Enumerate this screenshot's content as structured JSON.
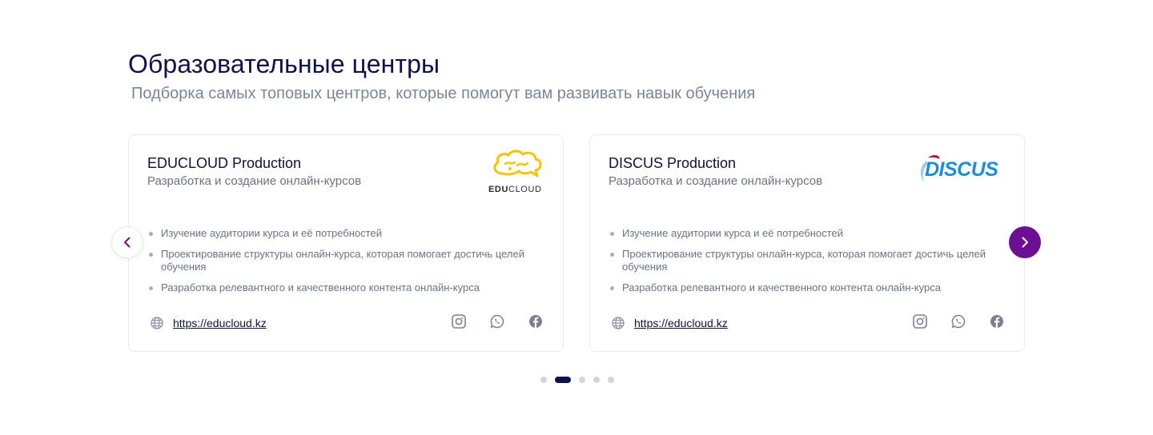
{
  "section": {
    "title": "Образовательные центры",
    "subtitle": "Подборка самых топовых центров, которые помогут вам развивать навык обучения"
  },
  "cards": [
    {
      "name": "EDUCLOUD Production",
      "description": "Разработка и создание онлайн-курсов",
      "logo_text_bold": "EDU",
      "logo_text_light": "CLOUD",
      "features": [
        "Изучение аудитории курса и её потребностей",
        "Проектирование структуры онлайн-курса, которая помогает достичь целей обучения",
        "Разработка релевантного и качественного контента онлайн-курса"
      ],
      "url": "https://educloud.kz",
      "socials": [
        "instagram-icon",
        "whatsapp-icon",
        "facebook-icon"
      ]
    },
    {
      "name": "DISCUS Production",
      "description": "Разработка и создание онлайн-курсов",
      "logo_text": "DISCUS",
      "features": [
        "Изучение аудитории курса и её потребностей",
        "Проектирование структуры онлайн-курса, которая помогает достичь целей обучения",
        "Разработка релевантного и качественного контента онлайн-курса"
      ],
      "url": "https://educloud.kz",
      "socials": [
        "instagram-icon",
        "whatsapp-icon",
        "facebook-icon"
      ]
    }
  ],
  "carousel": {
    "dot_count": 5,
    "active_dot": 2
  },
  "colors": {
    "accent": "#6d0f93",
    "title": "#10104a",
    "educloud_yellow": "#f5c400",
    "discus_blue": "#1a8fd6",
    "discus_red": "#b8123a"
  }
}
